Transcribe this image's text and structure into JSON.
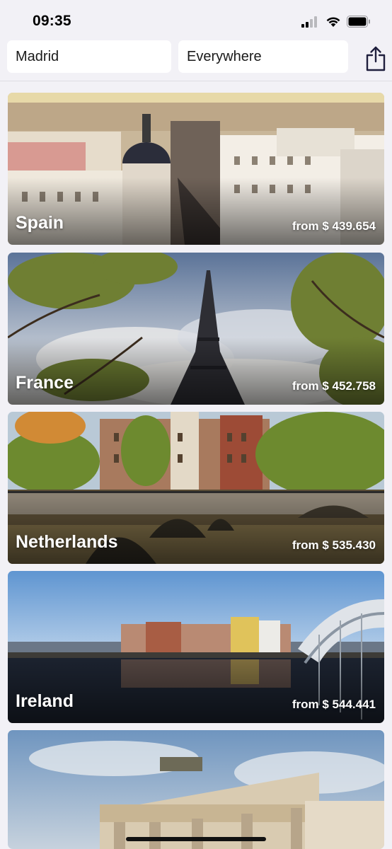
{
  "status_bar": {
    "time": "09:35",
    "icons": [
      "cellular-signal-icon",
      "wifi-icon",
      "battery-icon"
    ]
  },
  "search": {
    "origin": "Madrid",
    "destination": "Everywhere",
    "share_icon": "share-icon"
  },
  "destinations": [
    {
      "name": "Spain",
      "price": "from $ 439.654",
      "scene": "city-buildings"
    },
    {
      "name": "France",
      "price": "from $ 452.758",
      "scene": "eiffel-tower"
    },
    {
      "name": "Netherlands",
      "price": "from $ 535.430",
      "scene": "canal-bridge"
    },
    {
      "name": "Ireland",
      "price": "from $ 544.441",
      "scene": "river-bridge"
    },
    {
      "name": "",
      "price": "",
      "scene": "gate-monument"
    }
  ],
  "colors": {
    "background": "#f2f1f6",
    "field_background": "#ffffff",
    "text": "#161616",
    "overlay_text": "#ffffff"
  }
}
